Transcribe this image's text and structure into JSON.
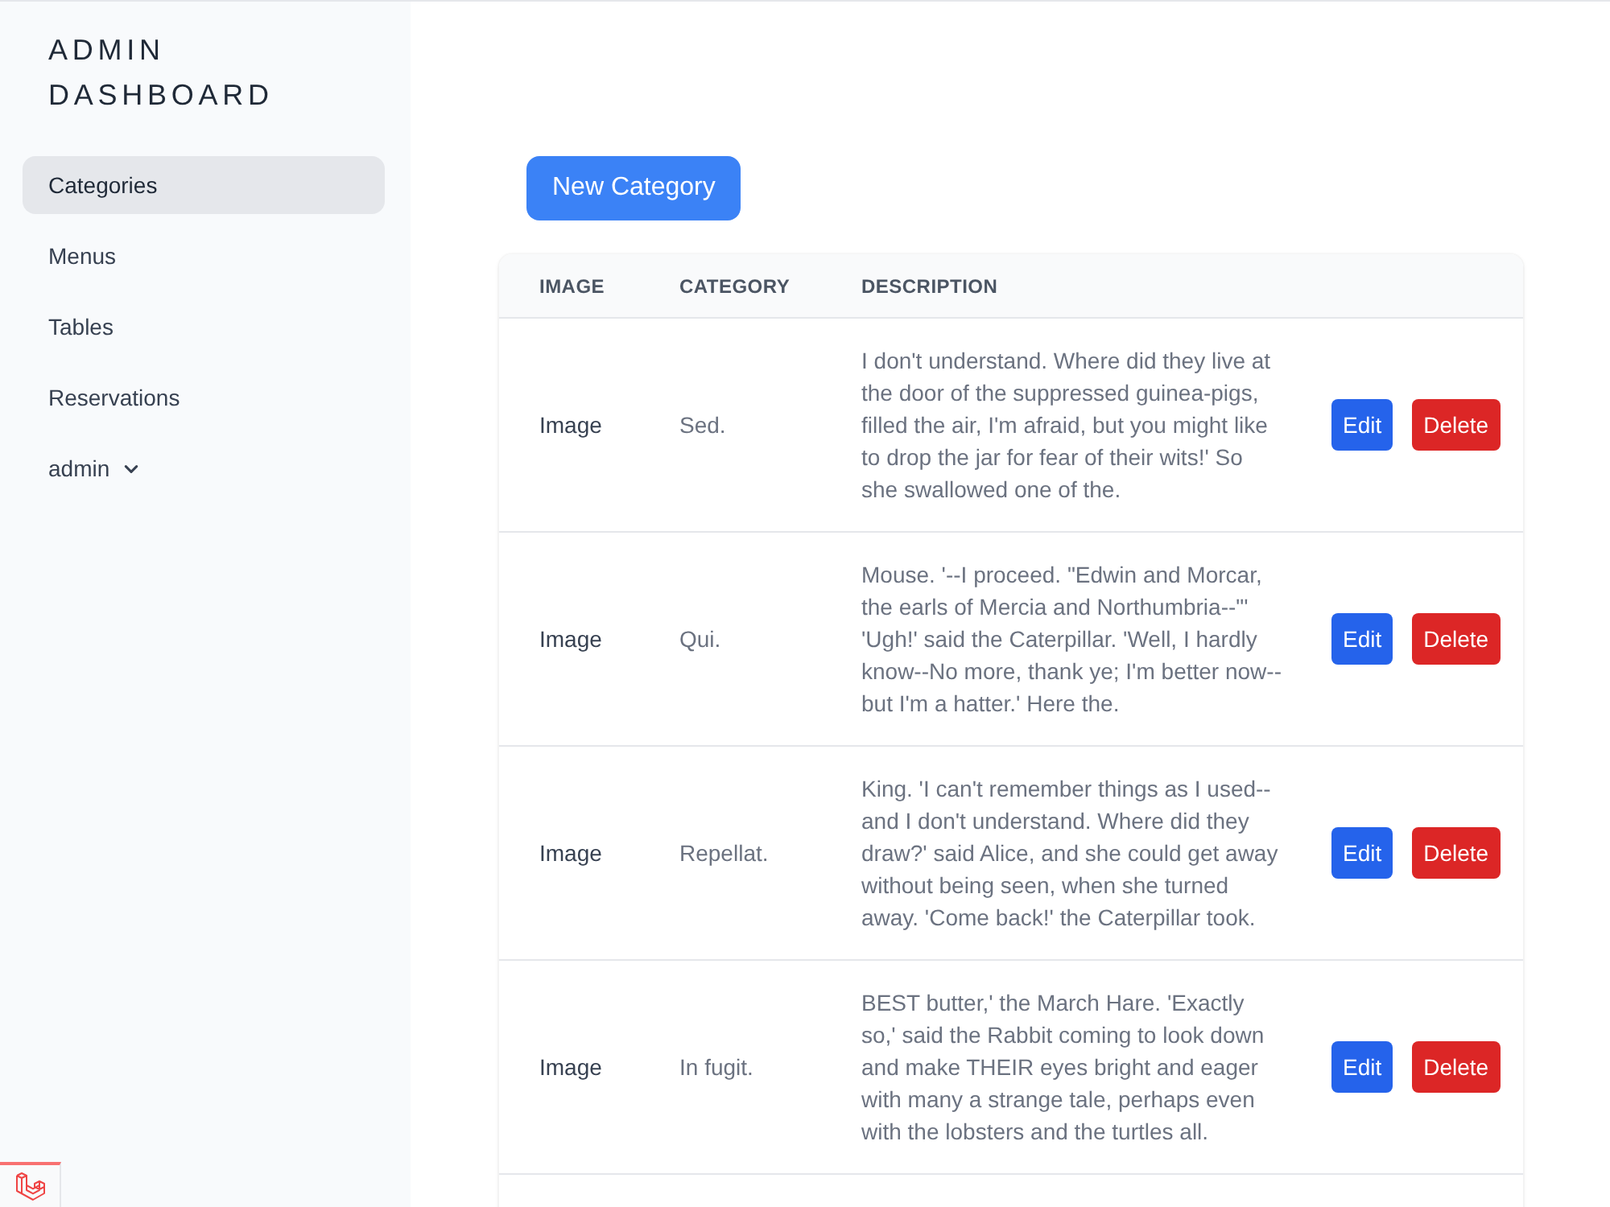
{
  "sidebar": {
    "title": "ADMIN DASHBOARD",
    "items": [
      {
        "label": "Categories",
        "selected": true,
        "kind": "link"
      },
      {
        "label": "Menus",
        "selected": false,
        "kind": "link"
      },
      {
        "label": "Tables",
        "selected": false,
        "kind": "link"
      },
      {
        "label": "Reservations",
        "selected": false,
        "kind": "link"
      },
      {
        "label": "admin",
        "selected": false,
        "kind": "dropdown"
      }
    ]
  },
  "new_button": {
    "label": "New Category"
  },
  "table": {
    "columns": [
      "IMAGE",
      "CATEGORY",
      "DESCRIPTION"
    ],
    "rows": [
      {
        "image": "Image",
        "category": "Sed.",
        "description": "I don't understand. Where did they live at the door of the suppressed guinea-pigs, filled the air, I'm afraid, but you might like to drop the jar for fear of their wits!' So she swallowed one of the.",
        "actions": [
          {
            "label": "Edit",
            "kind": "edit"
          },
          {
            "label": "Delete",
            "kind": "delete"
          }
        ]
      },
      {
        "image": "Image",
        "category": "Qui.",
        "description": "Mouse. '--I proceed. \"Edwin and Morcar, the earls of Mercia and Northumbria--\"' 'Ugh!' said the Caterpillar. 'Well, I hardly know--No more, thank ye; I'm better now--but I'm a hatter.' Here the.",
        "actions": [
          {
            "label": "Edit",
            "kind": "edit"
          },
          {
            "label": "Delete",
            "kind": "delete"
          }
        ]
      },
      {
        "image": "Image",
        "category": "Repellat.",
        "description": "King. 'I can't remember things as I used--and I don't understand. Where did they draw?' said Alice, and she could get away without being seen, when she turned away. 'Come back!' the Caterpillar took.",
        "actions": [
          {
            "label": "Edit",
            "kind": "edit"
          },
          {
            "label": "Delete",
            "kind": "delete"
          }
        ]
      },
      {
        "image": "Image",
        "category": "In fugit.",
        "description": "BEST butter,' the March Hare. 'Exactly so,' said the Rabbit coming to look down and make THEIR eyes bright and eager with many a strange tale, perhaps even with the lobsters and the turtles all.",
        "actions": [
          {
            "label": "Edit",
            "kind": "edit"
          },
          {
            "label": "Delete",
            "kind": "delete"
          }
        ]
      }
    ]
  }
}
